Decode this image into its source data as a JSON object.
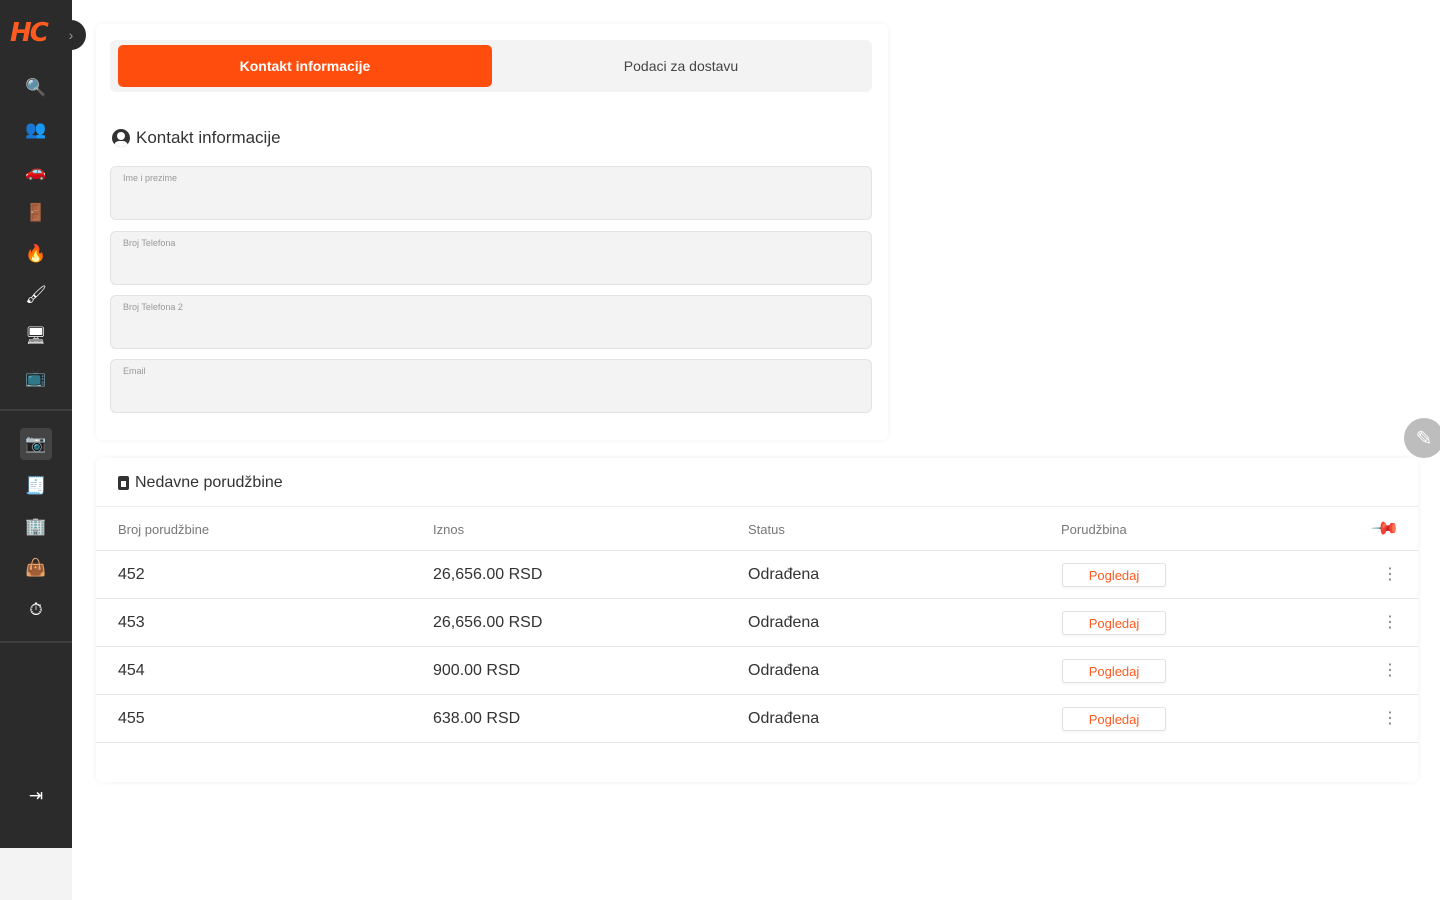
{
  "brand": {
    "logo_text": "HC",
    "accent": "#ff4d0e",
    "sidebar_bg": "#2b2b2b"
  },
  "sidebar": {
    "collapse_icon": "chevron-right-icon",
    "collapse_glyph": "›",
    "items": [
      {
        "icon": "search-icon",
        "glyph": "🔍"
      },
      {
        "icon": "users-icon",
        "glyph": "👥"
      },
      {
        "icon": "car-icon",
        "glyph": "🚗"
      },
      {
        "icon": "door-icon",
        "glyph": "🚪"
      },
      {
        "icon": "flame-icon",
        "glyph": "🔥"
      },
      {
        "icon": "paint-roller-icon",
        "glyph": "🖌"
      },
      {
        "icon": "monitor-icon",
        "glyph": "🖥"
      },
      {
        "icon": "tv-icon",
        "glyph": "📺"
      },
      {
        "icon": "camera-icon",
        "glyph": "📷"
      },
      {
        "icon": "receipt-icon",
        "glyph": "🧾"
      },
      {
        "icon": "building-icon",
        "glyph": "🏢"
      },
      {
        "icon": "bag-icon",
        "glyph": "👜"
      },
      {
        "icon": "gauge-icon",
        "glyph": "⏱"
      }
    ],
    "logout_icon": "logout-icon",
    "logout_glyph": "⇥"
  },
  "contact": {
    "tabs": [
      {
        "label": "Kontakt informacije",
        "active": true
      },
      {
        "label": "Podaci za dostavu",
        "active": false
      }
    ],
    "section_title": "Kontakt informacije",
    "fields": [
      {
        "label": "Ime i prezime",
        "value": ""
      },
      {
        "label": "Broj Telefona",
        "value": ""
      },
      {
        "label": "Broj Telefona 2",
        "value": ""
      },
      {
        "label": "Email",
        "value": ""
      }
    ]
  },
  "orders": {
    "title": "Nedavne porudžbine",
    "columns": [
      "Broj porudžbine",
      "Iznos",
      "Status",
      "Porudžbina"
    ],
    "pin_icon": "pin-icon",
    "pin_glyph": "📌",
    "rows": [
      {
        "number": "452",
        "amount": "26,656.00 RSD",
        "status": "Odrađena",
        "action": "Pogledaj"
      },
      {
        "number": "453",
        "amount": "26,656.00 RSD",
        "status": "Odrađena",
        "action": "Pogledaj"
      },
      {
        "number": "454",
        "amount": "900.00 RSD",
        "status": "Odrađena",
        "action": "Pogledaj"
      },
      {
        "number": "455",
        "amount": "638.00 RSD",
        "status": "Odrađena",
        "action": "Pogledaj"
      }
    ],
    "row_menu_glyph": "⋮"
  },
  "fab": {
    "icon": "edit-icon",
    "glyph": "✎"
  }
}
